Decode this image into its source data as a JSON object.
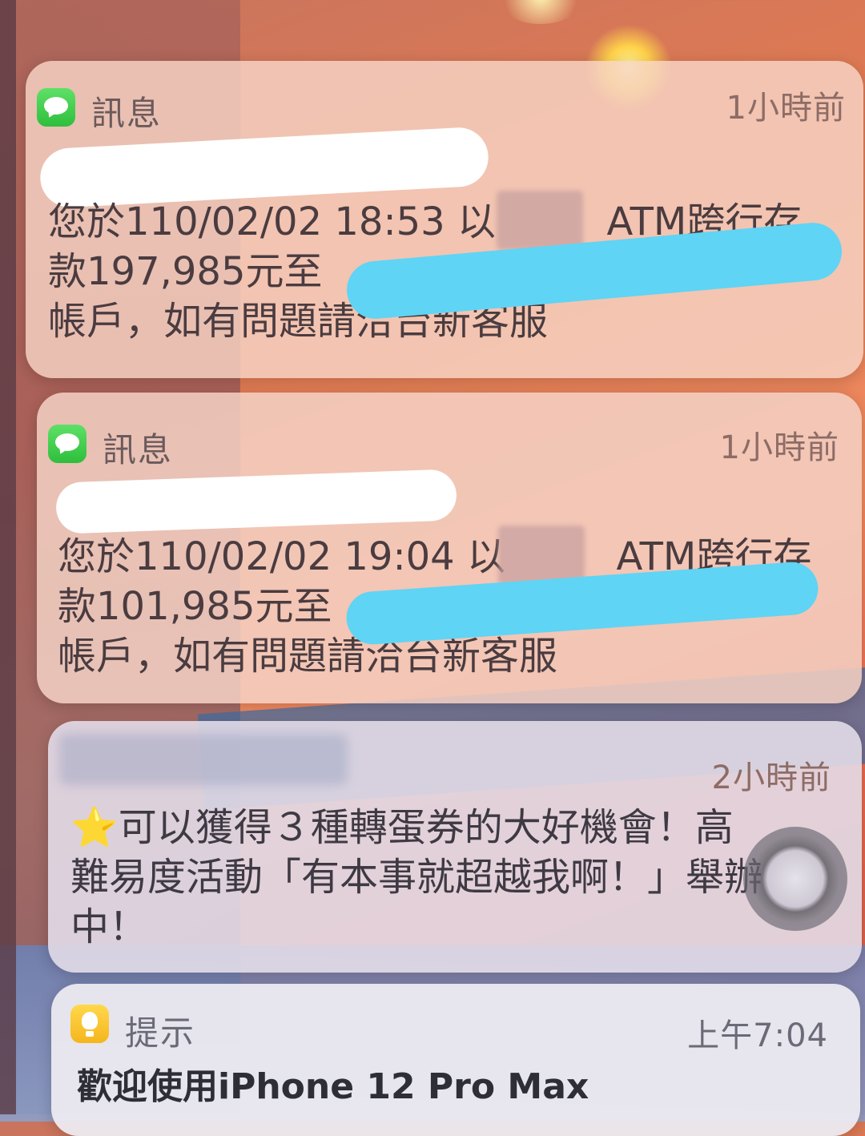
{
  "notifications": [
    {
      "app": "訊息",
      "app_icon": "messages-icon",
      "time": "1小時前",
      "lines": [
        "您於110/02/02 18:53 以",
        "ATM跨行存",
        "款197,985元至",
        "帳戶，如有問題請洽台新客服"
      ]
    },
    {
      "app": "訊息",
      "app_icon": "messages-icon",
      "time": "1小時前",
      "lines": [
        "您於110/02/02 19:04 以",
        "ATM跨行存",
        "款101,985元至",
        "帳戶，如有問題請洽台新客服"
      ]
    },
    {
      "app": "",
      "time": "2小時前",
      "lines": [
        "⭐可以獲得３種轉蛋券的大好機會！高",
        "難易度活動「有本事就超越我啊！」舉辦",
        "中！"
      ]
    },
    {
      "app": "提示",
      "app_icon": "tips-icon",
      "time": "上午7:04",
      "lines": [
        "歡迎使用iPhone 12 Pro Max"
      ]
    }
  ],
  "colors": {
    "messages_green": "#34c759",
    "tips_yellow": "#ffcc00",
    "redaction_cyan": "#5fd4f5"
  }
}
